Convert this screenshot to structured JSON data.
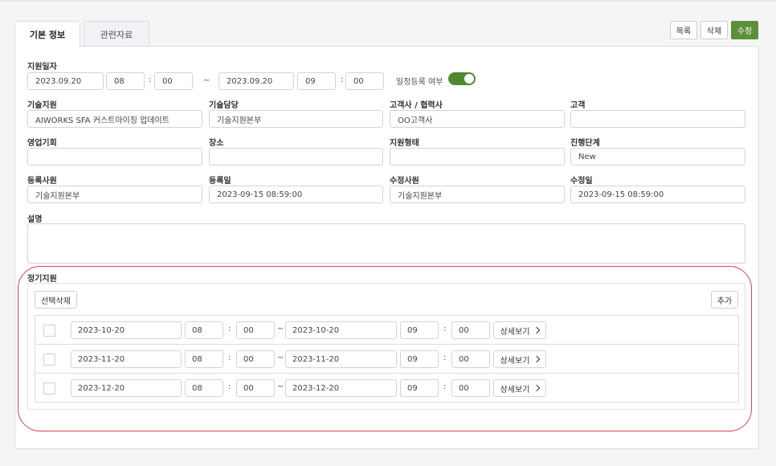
{
  "tabs": [
    {
      "label": "기본 정보"
    },
    {
      "label": "관련자료"
    }
  ],
  "toolbar": {
    "list_label": "목록",
    "delete_label": "삭제",
    "edit_label": "수정"
  },
  "schedule": {
    "label": "지원일자",
    "start_date": "2023.09.20",
    "start_hour": "08",
    "start_min": "00",
    "range_sep": "~",
    "end_date": "2023.09.20",
    "end_hour": "09",
    "end_min": "00",
    "time_sep": ":",
    "calendar_toggle_label": "일정등록 여부",
    "calendar_toggle_on": true
  },
  "fields": {
    "tech_support": {
      "label": "기술지원",
      "value": "AIWORKS SFA 커스트마이징 업데이트"
    },
    "tech_manager": {
      "label": "기술담당",
      "value": "기술지원본부"
    },
    "partner": {
      "label": "고객사 / 협력사",
      "value": "OO고객사"
    },
    "customer": {
      "label": "고객",
      "value": ""
    },
    "opportunity": {
      "label": "영업기회",
      "value": ""
    },
    "place": {
      "label": "장소",
      "value": ""
    },
    "support_type": {
      "label": "지원형태",
      "value": ""
    },
    "stage": {
      "label": "진행단계",
      "value": "New"
    },
    "registrar": {
      "label": "등록사원",
      "value": "기술지원본부"
    },
    "reg_date": {
      "label": "등록일",
      "value": "2023-09-15 08:59:00"
    },
    "editor": {
      "label": "수정사원",
      "value": "기술지원본부"
    },
    "edit_date": {
      "label": "수정일",
      "value": "2023-09-15 08:59:00"
    },
    "description": {
      "label": "설명",
      "value": ""
    }
  },
  "regular": {
    "title": "정기지원",
    "delete_selected_label": "선택삭제",
    "add_label": "추가",
    "detail_label": "상세보기",
    "rows": [
      {
        "start_date": "2023-10-20",
        "start_hour": "08",
        "start_min": "00",
        "end_date": "2023-10-20",
        "end_hour": "09",
        "end_min": "00"
      },
      {
        "start_date": "2023-11-20",
        "start_hour": "08",
        "start_min": "00",
        "end_date": "2023-11-20",
        "end_hour": "09",
        "end_min": "00"
      },
      {
        "start_date": "2023-12-20",
        "start_hour": "08",
        "start_min": "00",
        "end_date": "2023-12-20",
        "end_hour": "09",
        "end_min": "00"
      }
    ]
  },
  "colors": {
    "accent": "#5b8f3a",
    "toggle": "#4e8a32",
    "highlight": "#d9434a"
  }
}
